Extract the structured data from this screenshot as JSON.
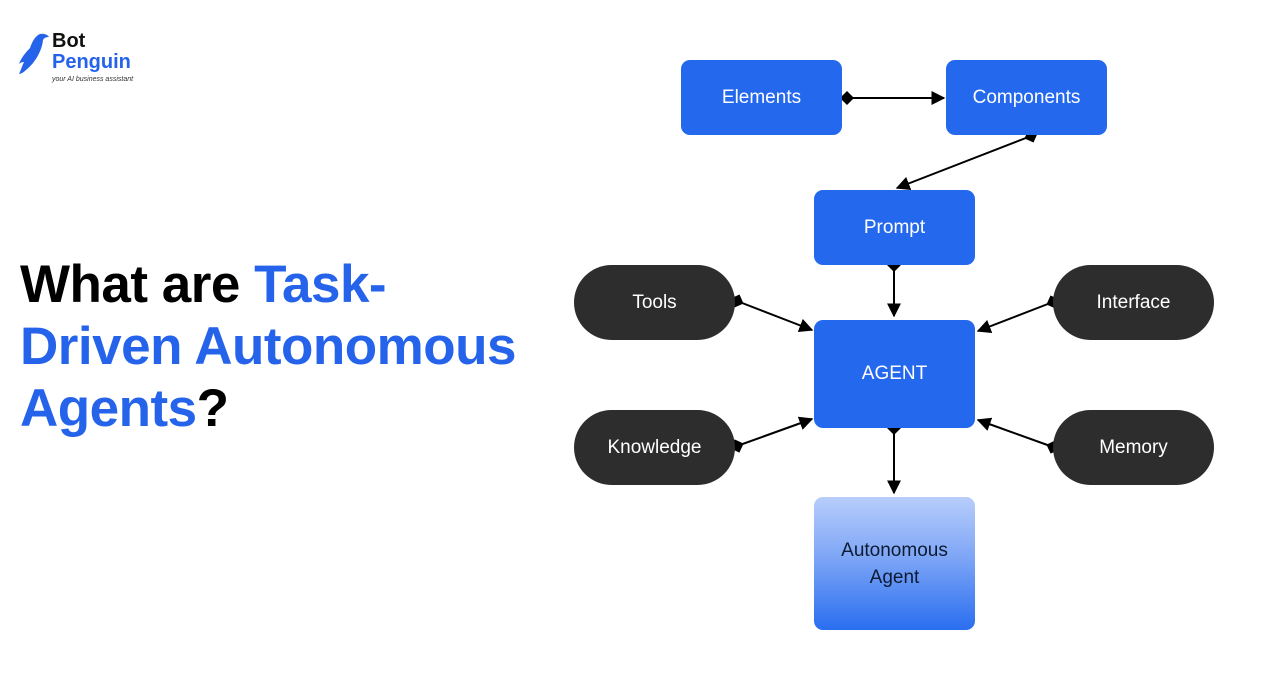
{
  "logo": {
    "brand_line1": "Bot",
    "brand_line2": "Penguin",
    "tagline": "your AI business assistant",
    "icon": "penguin-icon",
    "brand_color": "#2563eb"
  },
  "headline": {
    "part1": "What are ",
    "part2": "Task-",
    "part3": "Driven Autonomous",
    "part4": "Agents",
    "part5": "?",
    "accent_color": "#2563eb"
  },
  "diagram": {
    "colors": {
      "blue_node": "#2468ee",
      "dark_node": "#2d2d2d",
      "edge": "#000000"
    },
    "nodes": {
      "elements": "Elements",
      "components": "Components",
      "prompt": "Prompt",
      "agent": "AGENT",
      "tools": "Tools",
      "knowledge": "Knowledge",
      "interface": "Interface",
      "memory": "Memory",
      "autonomous_agent_line1": "Autonomous",
      "autonomous_agent_line2": "Agent"
    },
    "edges": [
      {
        "from": "Elements",
        "to": "Components"
      },
      {
        "from": "Components",
        "to": "Prompt"
      },
      {
        "from": "Prompt",
        "to": "AGENT"
      },
      {
        "from": "Tools",
        "to": "AGENT"
      },
      {
        "from": "Knowledge",
        "to": "AGENT"
      },
      {
        "from": "Interface",
        "to": "AGENT"
      },
      {
        "from": "Memory",
        "to": "AGENT"
      },
      {
        "from": "AGENT",
        "to": "Autonomous Agent"
      }
    ]
  }
}
